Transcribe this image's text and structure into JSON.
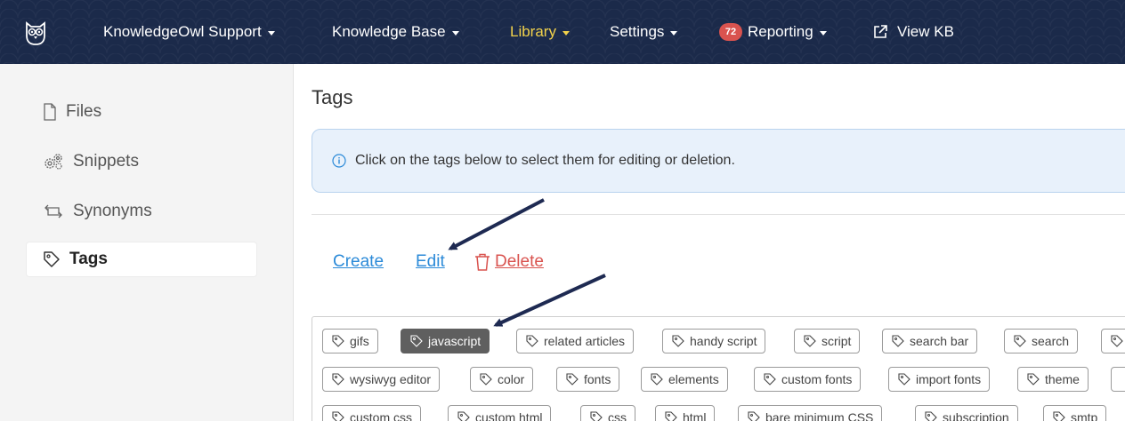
{
  "nav": {
    "items": [
      {
        "label": "KnowledgeOwl Support",
        "caret": true
      },
      {
        "label": "Knowledge Base",
        "caret": true
      },
      {
        "label": "Library",
        "caret": true,
        "active": true
      },
      {
        "label": "Settings",
        "caret": true
      },
      {
        "label": "Reporting",
        "caret": true,
        "badge": "72"
      },
      {
        "label": "View KB"
      }
    ],
    "accent_color": "#f2d24b",
    "background_color": "#1b2a4a"
  },
  "sidebar": {
    "items": [
      {
        "label": "Files",
        "icon": "file-icon"
      },
      {
        "label": "Snippets",
        "icon": "gears-icon"
      },
      {
        "label": "Synonyms",
        "icon": "swap-icon"
      },
      {
        "label": "Tags",
        "icon": "tag-icon",
        "active": true
      }
    ]
  },
  "main": {
    "title": "Tags",
    "info": "Click on the tags below to select them for editing or deletion.",
    "actions": {
      "create": "Create",
      "edit": "Edit",
      "delete": "Delete"
    },
    "tags": {
      "row1": [
        "gifs",
        "javascript",
        "related articles",
        "handy script",
        "script",
        "search bar",
        "search",
        ""
      ],
      "row2": [
        "wysiwyg editor",
        "color",
        "fonts",
        "elements",
        "custom fonts",
        "import fonts",
        "theme",
        ""
      ],
      "row3": [
        "custom css",
        "custom html",
        "css",
        "html",
        "bare minimum CSS",
        "subscription",
        "smtp"
      ]
    },
    "selected_tag": "javascript"
  }
}
